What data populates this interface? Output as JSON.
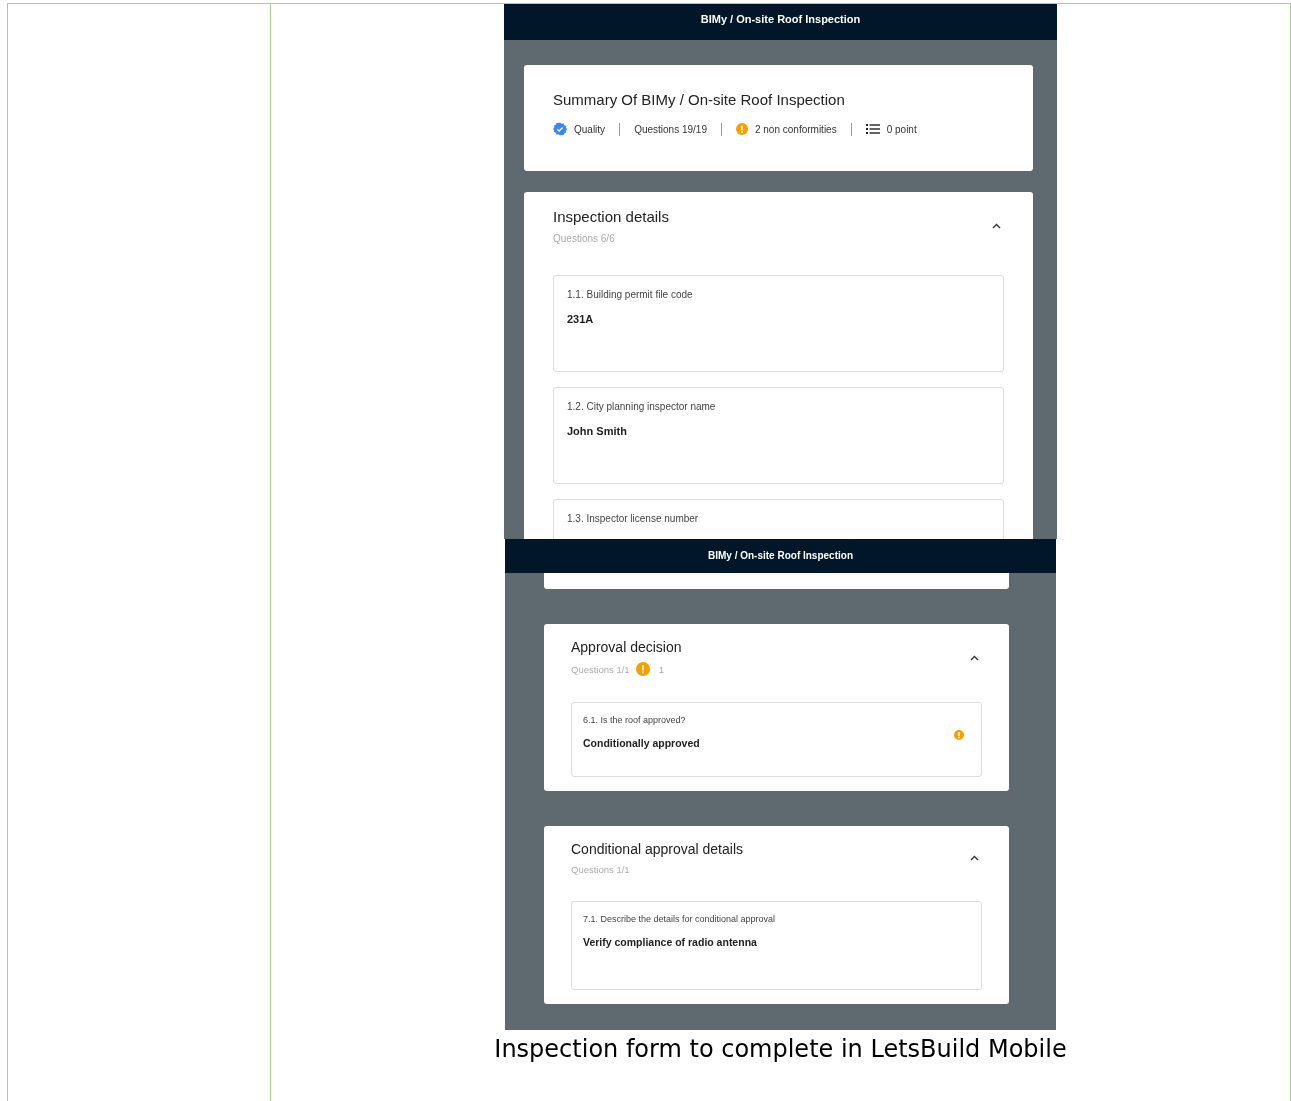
{
  "screenshots": [
    {
      "header": "BIMy / On-site Roof Inspection",
      "summary": {
        "title": "Summary Of BIMy / On-site Roof Inspection",
        "meta": [
          {
            "kind": "quality",
            "text": "Quality"
          },
          {
            "kind": "questions",
            "text": "Questions 19/19"
          },
          {
            "kind": "nonconformities",
            "text": "2 non conformities"
          },
          {
            "kind": "points",
            "text": "0 point"
          }
        ]
      },
      "sections": [
        {
          "kind": "card",
          "title": "Inspection details",
          "questions_label": "Questions 6/6",
          "expanded": true,
          "questions": [
            {
              "label": "1.1. Building permit file code",
              "answer": "231A",
              "nonconformity": false
            },
            {
              "label": "1.2. City planning inspector name",
              "answer": "John Smith",
              "nonconformity": false
            },
            {
              "label": "1.3. Inspector license number",
              "nonconformity": false
            }
          ]
        }
      ]
    },
    {
      "header": "BIMy / On-site Roof Inspection",
      "sections": [
        {
          "kind": "tail"
        },
        {
          "kind": "card",
          "title": "Approval decision",
          "questions_label": "Questions 1/1",
          "nonconformity_count": "1",
          "expanded": true,
          "questions": [
            {
              "label": "6.1. Is the roof approved?",
              "answer": "Conditionally approved",
              "nonconformity": true
            }
          ]
        },
        {
          "kind": "card",
          "title": "Conditional approval details",
          "questions_label": "Questions 1/1",
          "expanded": true,
          "questions": [
            {
              "label": "7.1. Describe the details for conditional approval",
              "answer": "Verify compliance of radio antenna",
              "nonconformity": false
            }
          ]
        }
      ]
    }
  ],
  "caption": "Inspection form to complete in LetsBuild Mobile"
}
